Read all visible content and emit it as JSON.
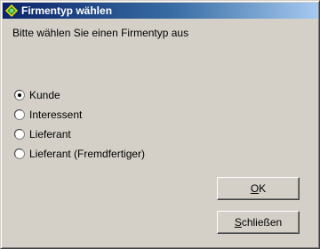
{
  "window": {
    "title": "Firmentyp wählen"
  },
  "dialog": {
    "prompt": "Bitte wählen Sie einen Firmentyp aus",
    "options": [
      {
        "label": "Kunde",
        "selected": true
      },
      {
        "label": "Interessent",
        "selected": false
      },
      {
        "label": "Lieferant",
        "selected": false
      },
      {
        "label": "Lieferant (Fremdfertiger)",
        "selected": false
      }
    ]
  },
  "buttons": {
    "ok_mnemonic": "O",
    "ok_rest": "K",
    "close_mnemonic": "S",
    "close_rest": "chließen"
  },
  "colors": {
    "face": "#d4d0c8",
    "title_start": "#0a246a",
    "title_end": "#a6caf0",
    "icon_green": "#2e9a2e"
  }
}
